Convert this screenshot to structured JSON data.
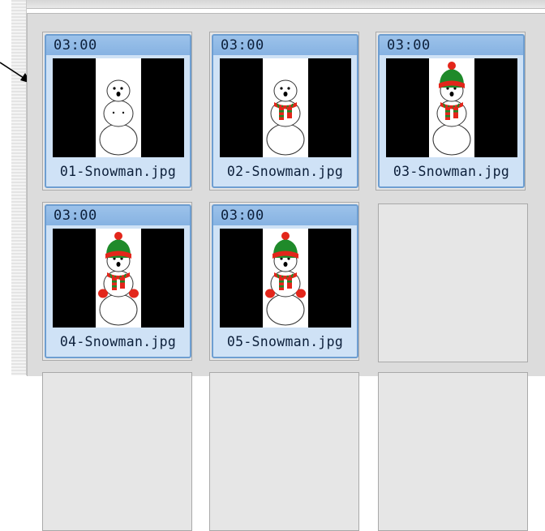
{
  "slides": [
    {
      "duration": "03:00",
      "filename": "01-Snowman.jpg",
      "stage": 1
    },
    {
      "duration": "03:00",
      "filename": "02-Snowman.jpg",
      "stage": 2
    },
    {
      "duration": "03:00",
      "filename": "03-Snowman.jpg",
      "stage": 3
    },
    {
      "duration": "03:00",
      "filename": "04-Snowman.jpg",
      "stage": 4
    },
    {
      "duration": "03:00",
      "filename": "05-Snowman.jpg",
      "stage": 5
    }
  ],
  "colors": {
    "tile_border": "#6e9ed1",
    "tile_header": "#86b2e2",
    "tile_body": "#cfe2f6",
    "hat_red": "#e3261b",
    "hat_green": "#1f8a2a"
  }
}
